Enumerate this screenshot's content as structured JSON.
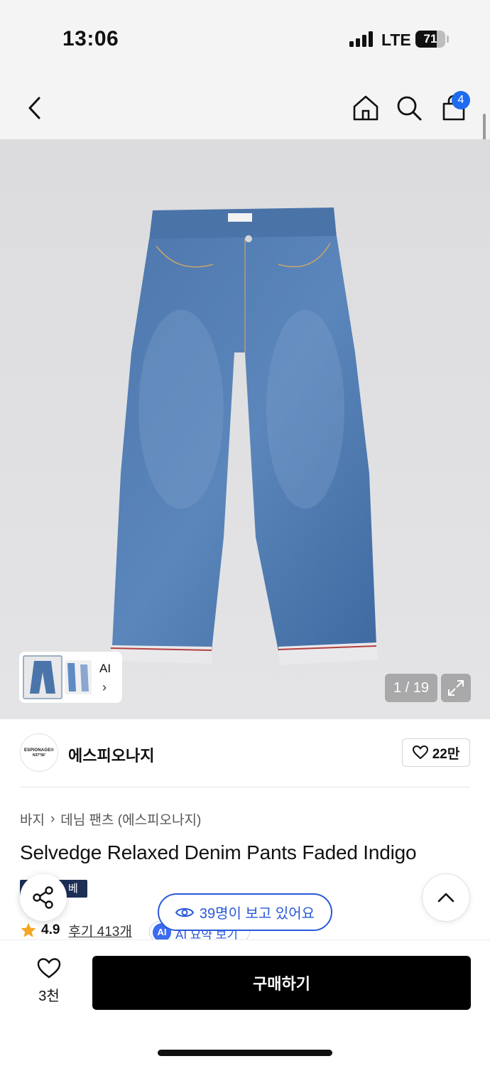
{
  "status_bar": {
    "time": "13:06",
    "network": "LTE",
    "battery": "71",
    "battery_level": 0.71
  },
  "nav": {
    "cart_count": "4",
    "icons": [
      "back-icon",
      "home-icon",
      "search-icon",
      "cart-icon"
    ]
  },
  "gallery": {
    "counter": "1 / 19",
    "thumb_ai_label": "AI",
    "thumb_arrow": "›"
  },
  "brand": {
    "logo_line1": "ESPIONAGE®",
    "logo_line2": "N37°56'",
    "name": "에스피오나지",
    "likes": "22만"
  },
  "breadcrumb": {
    "category": "바지",
    "separator": "›",
    "subcategory": "데님 팬츠 (에스피오나지)"
  },
  "product": {
    "title": "Selvedge Relaxed Denim Pants Faded Indigo",
    "tag": "베이"
  },
  "rating": {
    "score": "4.9",
    "reviews": "후기 413개",
    "ai_chip": "AI",
    "ai_text": "AI 요약 보기"
  },
  "viewers": {
    "text": "39명이 보고 있어요"
  },
  "bottom": {
    "wish_count": "3천",
    "buy_label": "구매하기"
  },
  "colors": {
    "accent": "#2a58d8",
    "badge": "#1e6bf0",
    "star": "#f5a623",
    "buy_button": "#000000",
    "tag_bg": "#1e2f57"
  }
}
